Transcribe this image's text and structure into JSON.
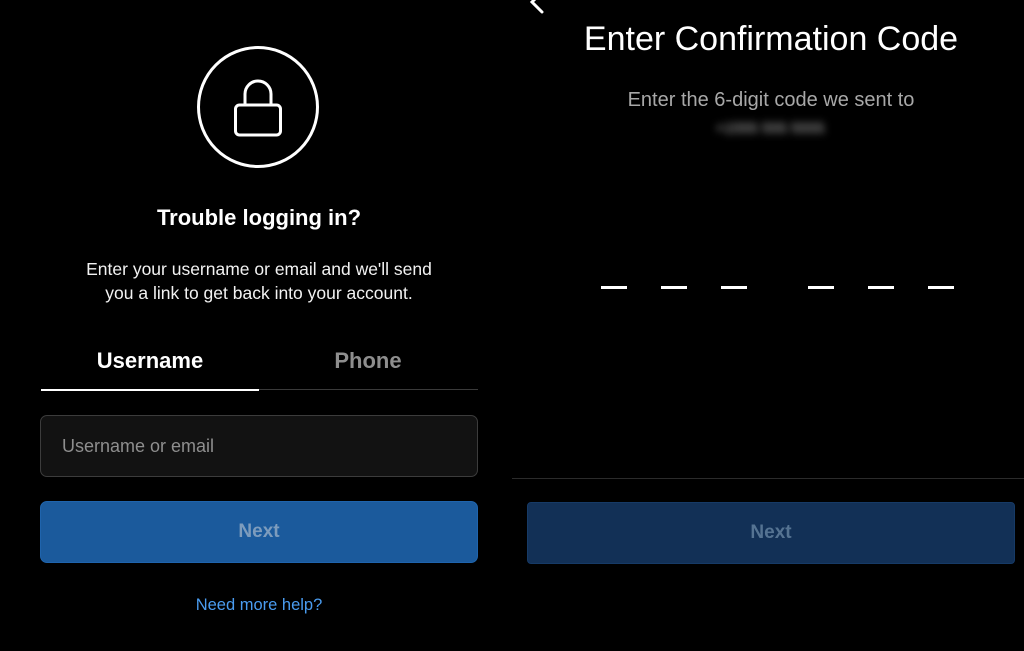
{
  "reset_screen": {
    "icon": "lock-icon",
    "title": "Trouble logging in?",
    "description": "Enter your username or email and we'll send you a link to get back into your account.",
    "tabs": [
      {
        "label": "Username",
        "active": true
      },
      {
        "label": "Phone",
        "active": false
      }
    ],
    "username_input": {
      "placeholder": "Username or email",
      "value": ""
    },
    "next_label": "Next",
    "help_link": "Need more help?"
  },
  "confirm_screen": {
    "back_icon": "chevron-left-icon",
    "title": "Enter Confirmation Code",
    "description": "Enter the 6-digit code we sent to",
    "phone_masked": "+1555 555 5555",
    "code_length": 6,
    "next_label": "Next"
  },
  "colors": {
    "background": "#000000",
    "button_blue": "#1b5a9c",
    "link_blue": "#4a9cf0"
  }
}
